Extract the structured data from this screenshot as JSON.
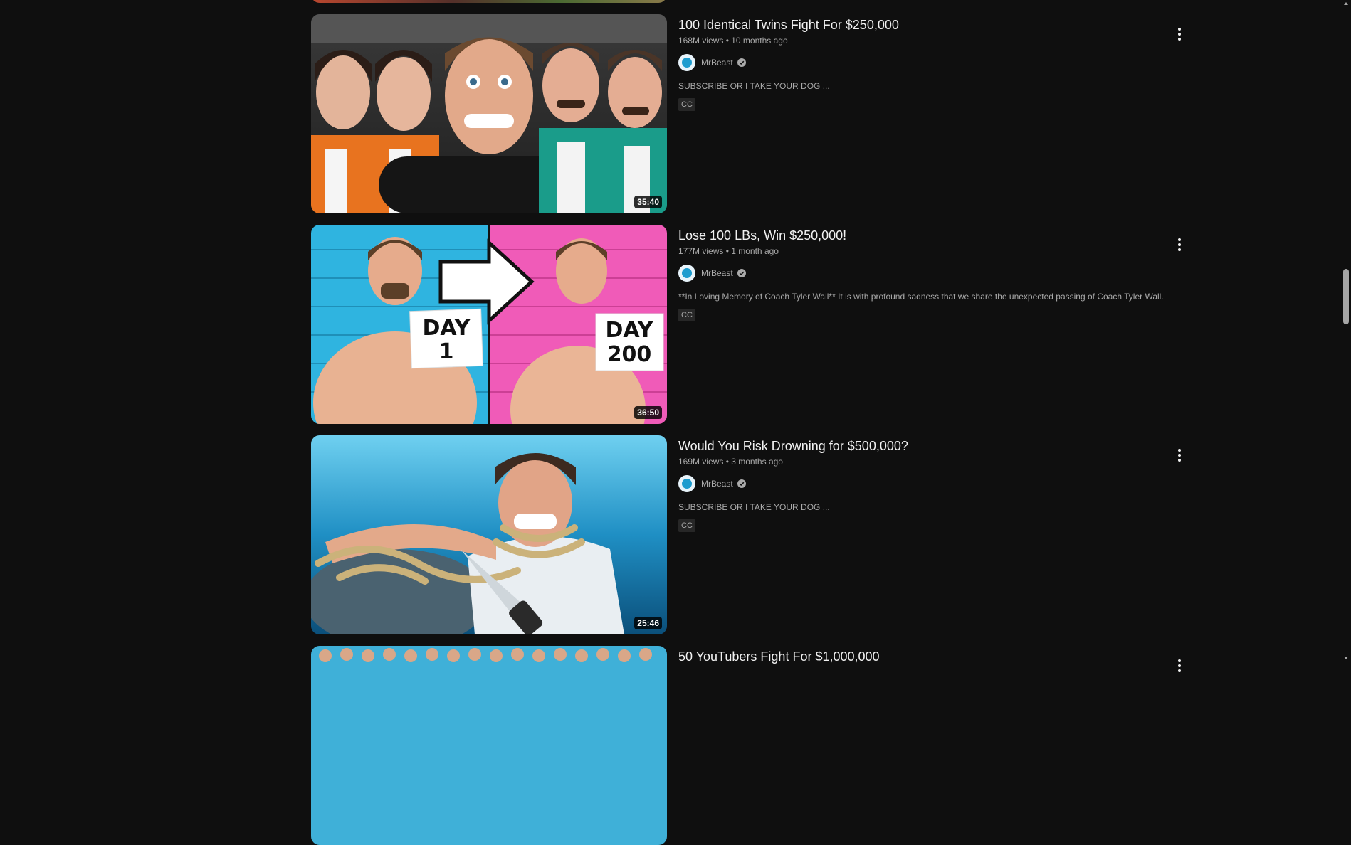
{
  "results": [
    {
      "title": "100 Identical Twins Fight For $250,000",
      "views": "168M views",
      "age": "10 months ago",
      "channel": "MrBeast",
      "description": "SUBSCRIBE OR I TAKE YOUR DOG ...",
      "badge": "CC",
      "duration": "35:40"
    },
    {
      "title": "Lose 100 LBs, Win $250,000!",
      "views": "177M views",
      "age": "1 month ago",
      "channel": "MrBeast",
      "description": "**In Loving Memory of Coach Tyler Wall** It is with profound sadness that we share the unexpected passing of Coach Tyler Wall.",
      "badge": "CC",
      "duration": "36:50",
      "thumb_text_left": [
        "DAY",
        "1"
      ],
      "thumb_text_right": [
        "DAY",
        "200"
      ]
    },
    {
      "title": "Would You Risk Drowning for $500,000?",
      "views": "169M views",
      "age": "3 months ago",
      "channel": "MrBeast",
      "description": "SUBSCRIBE OR I TAKE YOUR DOG ...",
      "badge": "CC",
      "duration": "25:46"
    },
    {
      "title": "50 YouTubers Fight For $1,000,000"
    }
  ],
  "separator": "•",
  "icons": {
    "menu": "more-vert-icon",
    "verified": "verified-check-icon"
  },
  "colors": {
    "background": "#0f0f0f",
    "title": "#f1f1f1",
    "secondary_text": "#aaaaaa",
    "badge_bg": "#272727"
  }
}
